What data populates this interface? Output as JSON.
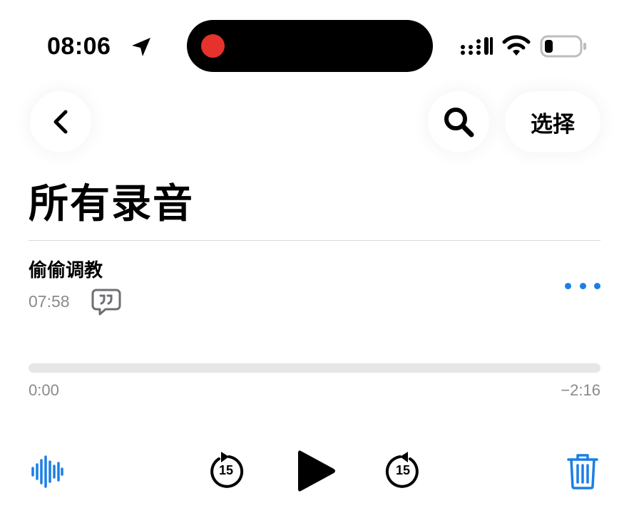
{
  "status_bar": {
    "time": "08:06",
    "icons": [
      "location-arrow-icon",
      "signal-icon",
      "wifi-icon",
      "battery-icon"
    ],
    "recording_indicator_color": "#e5322c"
  },
  "nav": {
    "back_icon": "chevron-left-icon",
    "search_icon": "search-icon",
    "select_label": "选择"
  },
  "page": {
    "title": "所有录音"
  },
  "recording": {
    "title": "偷偷调教",
    "duration": "07:58",
    "transcript_icon": "transcript-quote-icon",
    "more_icon": "ellipsis-icon"
  },
  "playback": {
    "elapsed": "0:00",
    "remaining": "−2:16",
    "progress_fraction": 0.0,
    "skip_back_seconds": "15",
    "skip_forward_seconds": "15"
  },
  "colors": {
    "accent": "#1a7fe6",
    "secondary_text": "#8a8a8e"
  }
}
